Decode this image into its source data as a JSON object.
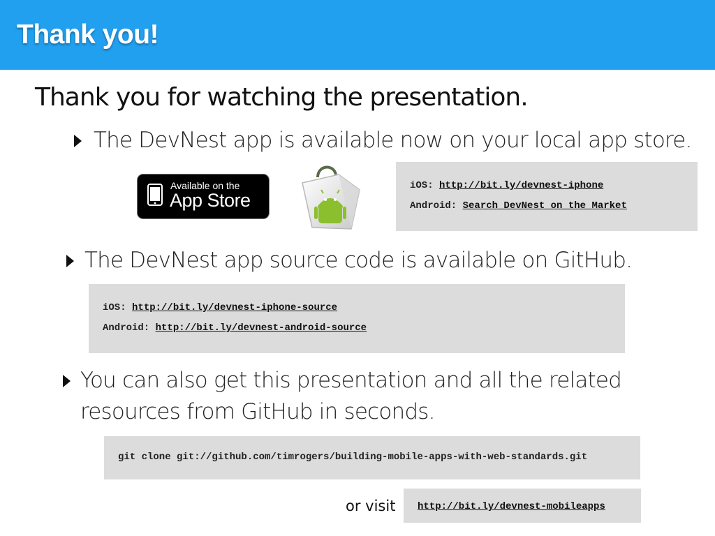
{
  "header": {
    "title": "Thank you!"
  },
  "subtitle": "Thank you for watching the presentation.",
  "bullets": [
    {
      "text": "The DevNest app is available now on your local app store."
    },
    {
      "text": "The DevNest app source code is available on GitHub."
    },
    {
      "line1": "You can also get this presentation and all the related",
      "line2": "resources from GitHub in seconds."
    }
  ],
  "badges": {
    "appstore": {
      "small": "Available on the",
      "big": "App Store",
      "icon": "apple-icon"
    },
    "market": {
      "icon": "android-market-bag-icon"
    }
  },
  "app_links": {
    "ios_label": "iOS:",
    "ios_link": "http://bit.ly/devnest-iphone",
    "android_label": "Android:",
    "android_link": "Search DevNest on the Market"
  },
  "source_links": {
    "ios_label": "iOS:",
    "ios_link": "http://bit.ly/devnest-iphone-source",
    "android_label": "Android:",
    "android_link": "http://bit.ly/devnest-android-source"
  },
  "git": {
    "command": "git clone git://github.com/timrogers/building-mobile-apps-with-web-standards.git"
  },
  "visit": {
    "label": "or visit",
    "link": "http://bit.ly/devnest-mobileapps"
  },
  "colors": {
    "header": "#22a0f0",
    "codebox": "#dcdcdc",
    "header_text": "#ffffff"
  }
}
